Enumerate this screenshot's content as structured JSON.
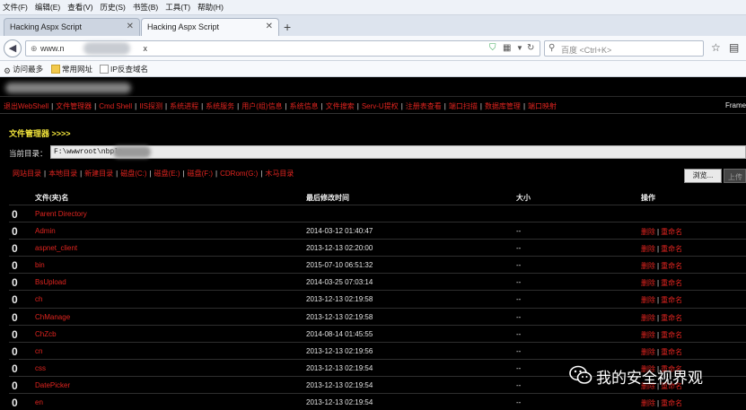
{
  "browser": {
    "menu": [
      "文件(F)",
      "编辑(E)",
      "查看(V)",
      "历史(S)",
      "书签(B)",
      "工具(T)",
      "帮助(H)"
    ],
    "tabs": [
      {
        "title": "Hacking Aspx Script",
        "active": false
      },
      {
        "title": "Hacking Aspx Script",
        "active": true
      }
    ],
    "new_tab_glyph": "+",
    "url_prefix": "www.n",
    "url_suffix": "x",
    "search_placeholder": "百度 <Ctrl+K>",
    "bookmarks": [
      "访问最多",
      "常用网址",
      "IP反查域名"
    ],
    "icons": [
      "back-arrow-icon",
      "globe-icon",
      "shield-icon",
      "qr-code-icon",
      "dropdown-icon",
      "reload-icon",
      "search-icon",
      "star-icon",
      "reading-list-icon"
    ]
  },
  "shell": {
    "nav_links": [
      "退出WebShell",
      "文件管理器",
      "Cmd Shell",
      "IIS探测",
      "系统进程",
      "系统服务",
      "用户(组)信息",
      "系统信息",
      "文件搜索",
      "Serv-U提权",
      "注册表查看",
      "端口扫描",
      "数据库管理",
      "端口映射"
    ],
    "frame_label": "Frame",
    "file_manager_title": "文件管理器 >>>>",
    "current_dir_label": "当前目录：",
    "current_dir_value": "F:\\wwwroot\\nbpla",
    "dir_links": [
      "网站目录",
      "本地目录",
      "新建目录",
      "磁盘(C:)",
      "磁盘(E:)",
      "磁盘(F:)",
      "CDRom(G:)",
      "木马目录"
    ],
    "browse_button": "浏览...",
    "browse_extra": "上传",
    "columns": {
      "name": "文件(夹)名",
      "modified": "最后修改时间",
      "size": "大小",
      "action": "操作"
    },
    "row_icon": "0",
    "op_delete": "删除",
    "op_rename": "重命名",
    "rows": [
      {
        "name": "Parent Directory",
        "modified": "",
        "size": ""
      },
      {
        "name": "Admin",
        "modified": "2014-03-12 01:40:47",
        "size": "--"
      },
      {
        "name": "aspnet_client",
        "modified": "2013-12-13 02:20:00",
        "size": "--"
      },
      {
        "name": "bin",
        "modified": "2015-07-10 06:51:32",
        "size": "--"
      },
      {
        "name": "BsUpload",
        "modified": "2014-03-25 07:03:14",
        "size": "--"
      },
      {
        "name": "ch",
        "modified": "2013-12-13 02:19:58",
        "size": "--"
      },
      {
        "name": "ChManage",
        "modified": "2013-12-13 02:19:58",
        "size": "--"
      },
      {
        "name": "ChZcb",
        "modified": "2014-08-14 01:45:55",
        "size": "--"
      },
      {
        "name": "cn",
        "modified": "2013-12-13 02:19:56",
        "size": "--"
      },
      {
        "name": "css",
        "modified": "2013-12-13 02:19:54",
        "size": "--"
      },
      {
        "name": "DatePicker",
        "modified": "2013-12-13 02:19:54",
        "size": "--"
      },
      {
        "name": "en",
        "modified": "2013-12-13 02:19:54",
        "size": "--"
      }
    ]
  },
  "watermark": {
    "text": "我的安全视界观",
    "icon": "wechat-icon"
  }
}
